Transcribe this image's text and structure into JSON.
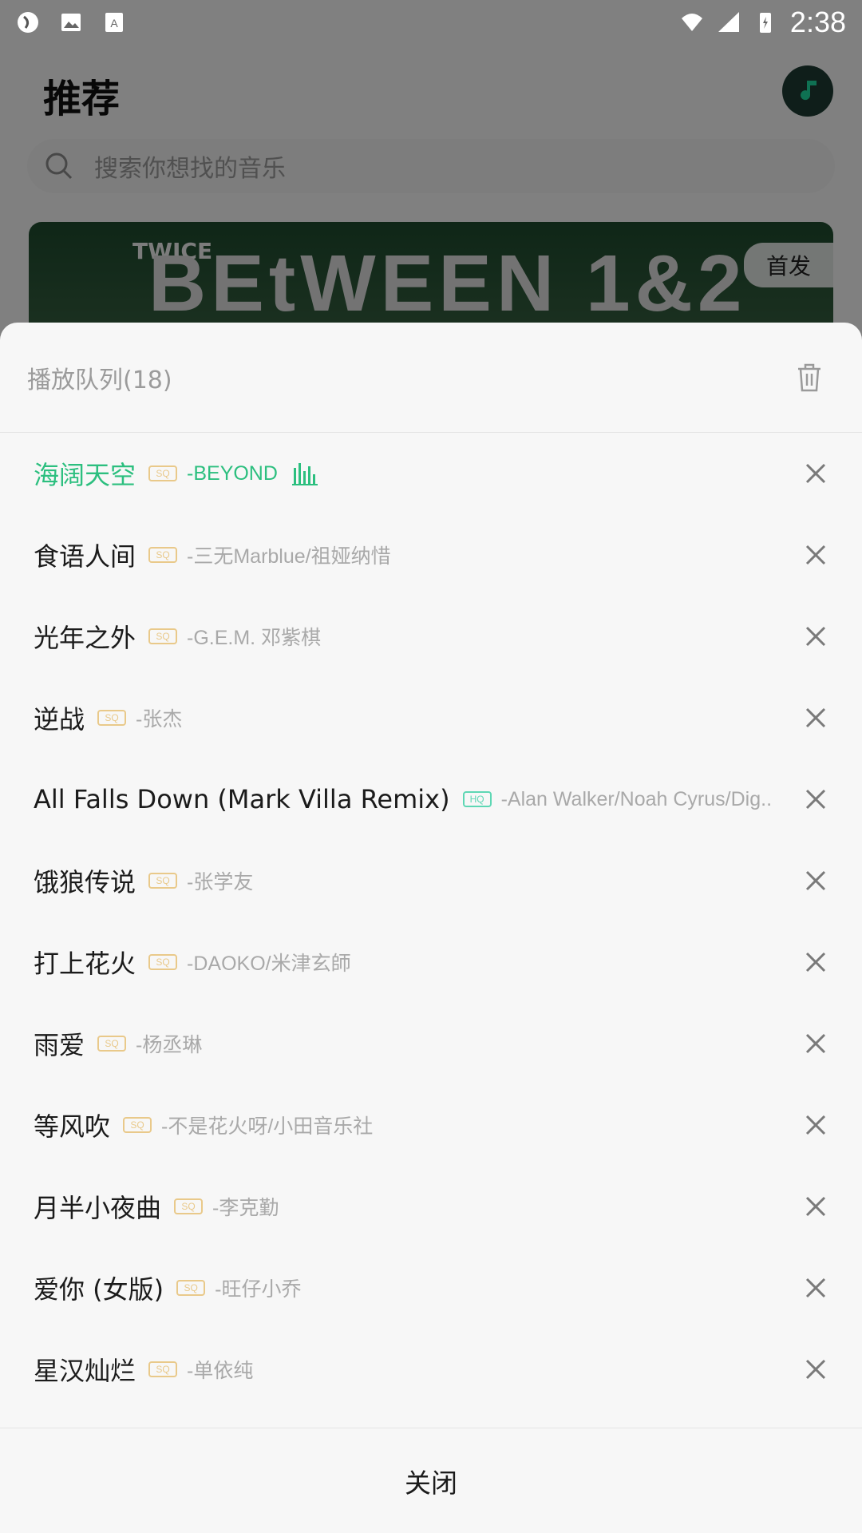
{
  "status_bar": {
    "time": "2:38"
  },
  "background": {
    "title": "推荐",
    "search_placeholder": "搜索你想找的音乐",
    "banner_badge": "首发",
    "banner_text": "BEtWEEN 1&2",
    "banner_logo": "TWICE"
  },
  "queue": {
    "title": "播放队列(18)",
    "items": [
      {
        "name": "海阔天空",
        "quality": "SQ",
        "artist": "-BEYOND",
        "playing": true
      },
      {
        "name": "食语人间",
        "quality": "SQ",
        "artist": "-三无Marblue/祖娅纳惜"
      },
      {
        "name": "光年之外",
        "quality": "SQ",
        "artist": "-G.E.M. 邓紫棋"
      },
      {
        "name": "逆战",
        "quality": "SQ",
        "artist": "-张杰"
      },
      {
        "name": "All Falls Down (Mark Villa Remix)",
        "quality": "HQ",
        "artist": "-Alan Walker/Noah Cyrus/Dig.."
      },
      {
        "name": "饿狼传说",
        "quality": "SQ",
        "artist": "-张学友"
      },
      {
        "name": "打上花火",
        "quality": "SQ",
        "artist": "-DAOKO/米津玄師"
      },
      {
        "name": "雨爱",
        "quality": "SQ",
        "artist": "-杨丞琳"
      },
      {
        "name": "等风吹",
        "quality": "SQ",
        "artist": "-不是花火呀/小田音乐社"
      },
      {
        "name": "月半小夜曲",
        "quality": "SQ",
        "artist": "-李克勤"
      },
      {
        "name": "爱你 (女版)",
        "quality": "SQ",
        "artist": "-旺仔小乔"
      },
      {
        "name": "星汉灿烂",
        "quality": "SQ",
        "artist": "-单依纯"
      }
    ],
    "close_label": "关闭"
  },
  "colors": {
    "accent": "#2cbf7f",
    "sq_badge": "#e9c98a",
    "hq_badge": "#5ed7b4"
  }
}
